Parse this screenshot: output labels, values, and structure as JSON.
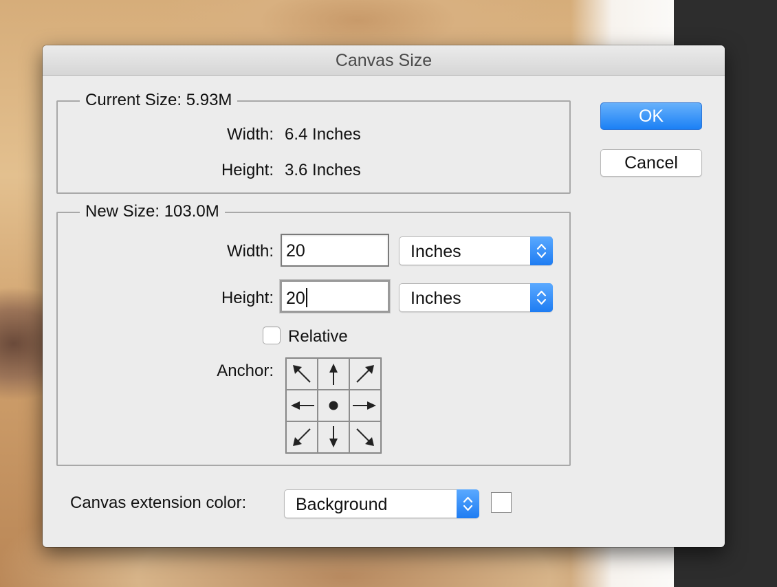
{
  "dialog": {
    "title": "Canvas Size"
  },
  "current_size": {
    "legend": "Current Size: 5.93M",
    "width_label": "Width:",
    "width_value": "6.4 Inches",
    "height_label": "Height:",
    "height_value": "3.6 Inches"
  },
  "new_size": {
    "legend": "New Size: 103.0M",
    "width_label": "Width:",
    "width_value": "20",
    "width_unit": "Inches",
    "height_label": "Height:",
    "height_value": "20",
    "height_unit": "Inches",
    "relative_label": "Relative",
    "relative_checked": false,
    "anchor_label": "Anchor:",
    "anchor_cells": [
      {
        "icon": "arrow-up-left-icon"
      },
      {
        "icon": "arrow-up-icon"
      },
      {
        "icon": "arrow-up-right-icon"
      },
      {
        "icon": "arrow-left-icon"
      },
      {
        "icon": "anchor-center-dot-icon"
      },
      {
        "icon": "arrow-right-icon"
      },
      {
        "icon": "arrow-down-left-icon"
      },
      {
        "icon": "arrow-down-icon"
      },
      {
        "icon": "arrow-down-right-icon"
      }
    ]
  },
  "extension": {
    "label": "Canvas extension color:",
    "value": "Background",
    "swatch_color": "#ffffff"
  },
  "buttons": {
    "ok": "OK",
    "cancel": "Cancel"
  },
  "colors": {
    "accent": "#1b80f5",
    "dialog_bg": "#ececec"
  }
}
